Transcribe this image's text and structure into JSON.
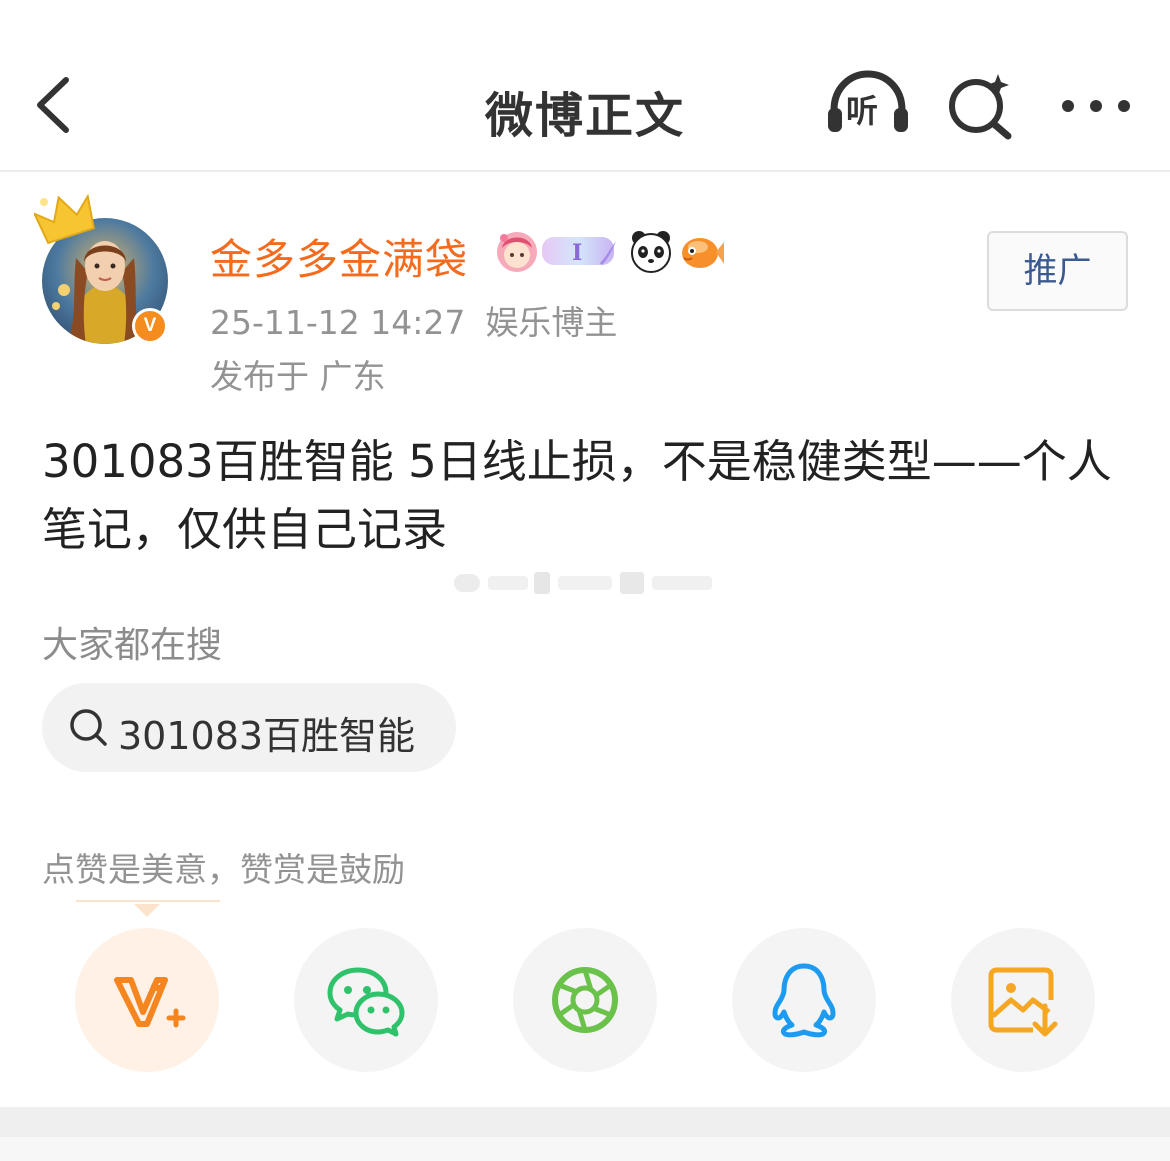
{
  "nav": {
    "title": "微博正文",
    "listen_label": "听",
    "back_icon": "chevron-left-icon",
    "search_icon": "search-sparkle-icon",
    "more_icon": "more-dots-icon"
  },
  "author": {
    "name": "金多多金满袋",
    "post_date": "25-11-12 14:27",
    "author_type": "娱乐博主",
    "location": "发布于 广东",
    "verified": true,
    "name_color": "#f56b1e",
    "badge_icons": [
      "princess-avatar-badge",
      "level-one-badge",
      "panda-badge",
      "fish-badge"
    ],
    "level_badge_text": "I"
  },
  "promote": {
    "label": "推广"
  },
  "post": {
    "text": "301083百胜智能 5日线止损，不是稳健类型——个人笔记，仅供自己记录"
  },
  "search_suggest": {
    "label": "大家都在搜",
    "chip_text": "301083百胜智能"
  },
  "reward_tip": {
    "text": "点赞是美意，赞赏是鼓励"
  },
  "share": {
    "items": [
      {
        "name": "reward",
        "icon": "v-plus-icon",
        "color": "#f5861f"
      },
      {
        "name": "wechat",
        "icon": "wechat-icon",
        "color": "#2fc26b"
      },
      {
        "name": "moments",
        "icon": "wechat-moments-icon",
        "color": "#6ac24b"
      },
      {
        "name": "qq",
        "icon": "qq-icon",
        "color": "#1d9bf0"
      },
      {
        "name": "save-image",
        "icon": "save-image-icon",
        "color": "#f5a623"
      }
    ]
  },
  "colors": {
    "accent_orange": "#f56b1e",
    "meta_gray": "#939393",
    "promote_blue": "#3a5a90"
  }
}
